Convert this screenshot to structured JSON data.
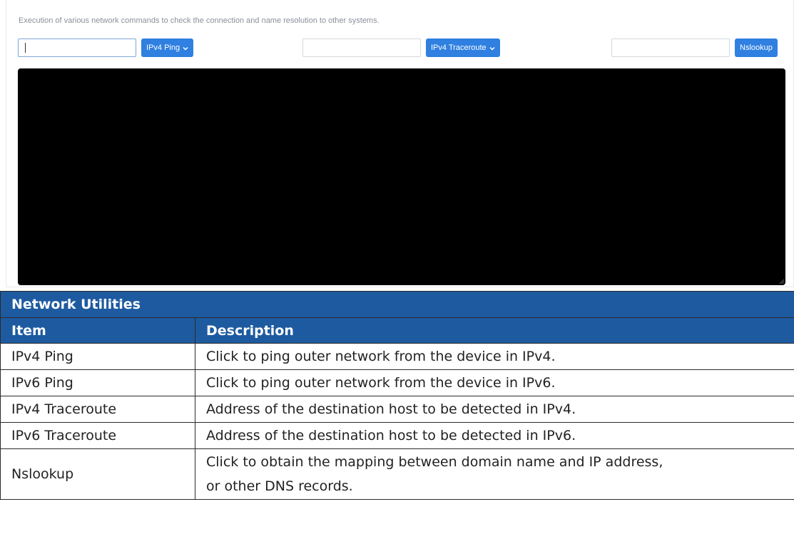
{
  "panel": {
    "intro": "Execution of various network commands to check the connection and name resolution to other systems.",
    "ping_button": "IPv4 Ping",
    "traceroute_button": "IPv4 Traceroute",
    "nslookup_button": "Nslookup",
    "ping_input_value": "",
    "traceroute_input_value": "",
    "nslookup_input_value": "",
    "accent_color": "#2f80e0",
    "terminal_color": "#000000"
  },
  "table": {
    "title": "Network Utilities",
    "headers": [
      "Item",
      "Description"
    ],
    "header_color": "#1e5aa0",
    "rows": [
      {
        "item": "IPv4 Ping",
        "description": "Click to ping outer network from the device in IPv4."
      },
      {
        "item": "IPv6 Ping",
        "description": "Click to ping outer network from the device in IPv6."
      },
      {
        "item": "IPv4 Traceroute",
        "description": "Address of the destination host to be detected in IPv4."
      },
      {
        "item": "IPv6 Traceroute",
        "description": "Address of the destination host to be detected in IPv6."
      },
      {
        "item": "Nslookup",
        "description": "Click to obtain the mapping between domain name and IP address, or other DNS records."
      }
    ]
  }
}
